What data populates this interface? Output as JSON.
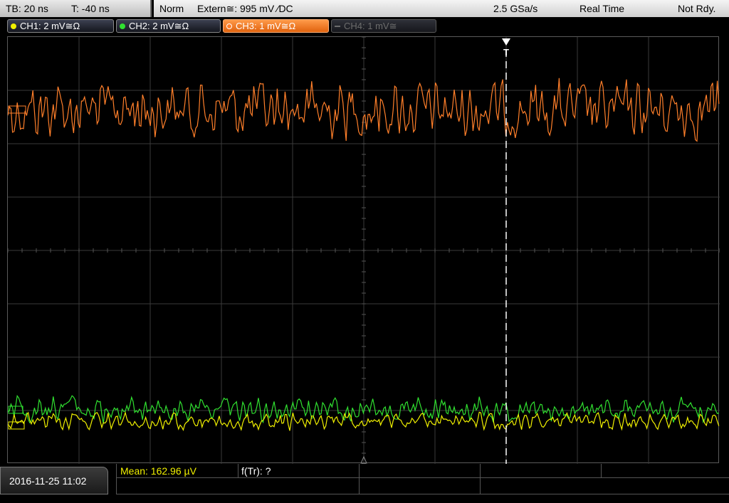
{
  "timebase": {
    "tb": "TB: 20 ns",
    "t": "T: -40 ns"
  },
  "trigger_status": {
    "mode": "Norm",
    "source": "Extern≅: 995 mV ⁄DC",
    "sample_rate": "2.5 GSa/s",
    "acquisition": "Real Time",
    "state": "Not Rdy."
  },
  "channels": [
    {
      "label": "CH1: 2 mV≅Ω",
      "color": "#f0f000",
      "state": "on"
    },
    {
      "label": "CH2: 2 mV≅Ω",
      "color": "#30e030",
      "state": "on"
    },
    {
      "label": "CH3: 1 mV≅Ω",
      "color": "#ff7f2a",
      "state": "selected"
    },
    {
      "label": "CH4: 1 mV≅",
      "color": "#7a7a7a",
      "state": "off"
    }
  ],
  "trigger_marker": "T",
  "measurements": {
    "mean": "Mean: 162.96 µV",
    "freq": "f(Tr): ?"
  },
  "datetime": "2016-11-25 11:02",
  "colors": {
    "grid": "#3a3a3a",
    "ch1": "#f0f000",
    "ch2": "#30e030",
    "ch3": "#ff7f2a",
    "mean_text": "#f0f000"
  },
  "icons": [
    "trigger-arrow-icon",
    "ground-marker-icon"
  ]
}
